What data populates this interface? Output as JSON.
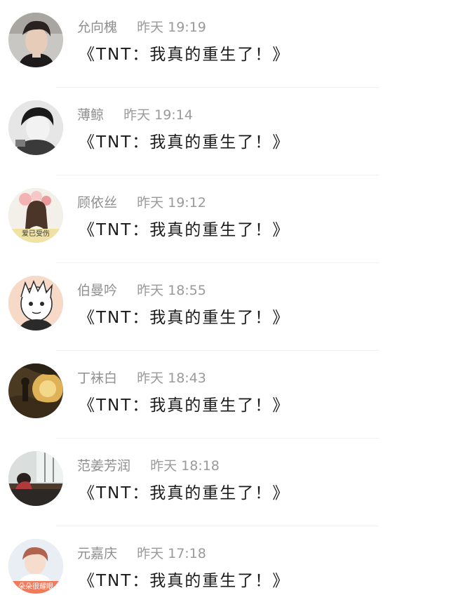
{
  "comments": [
    {
      "name": "允向槐",
      "time": "昨天 19:19",
      "text": "《TNT：我真的重生了！》",
      "avatar": "avatar-boy-dark"
    },
    {
      "name": "薄鲸",
      "time": "昨天 19:14",
      "text": "《TNT：我真的重生了！》",
      "avatar": "avatar-boy-bw"
    },
    {
      "name": "顾依丝",
      "time": "昨天 19:12",
      "text": "《TNT：我真的重生了！》",
      "avatar": "avatar-girl-flowers",
      "avatar_caption": "爱已受伤"
    },
    {
      "name": "伯曼吟",
      "time": "昨天 18:55",
      "text": "《TNT：我真的重生了！》",
      "avatar": "avatar-cartoon-sketch"
    },
    {
      "name": "丁袜白",
      "time": "昨天 18:43",
      "text": "《TNT：我真的重生了！》",
      "avatar": "avatar-sunset-landscape"
    },
    {
      "name": "范姜芳润",
      "time": "昨天 18:18",
      "text": "《TNT：我真的重生了！》",
      "avatar": "avatar-classroom"
    },
    {
      "name": "元嘉庆",
      "time": "昨天 17:18",
      "text": "《TNT：我真的重生了！》",
      "avatar": "avatar-boy-light",
      "avatar_caption": "朵朵很耀眼"
    }
  ]
}
